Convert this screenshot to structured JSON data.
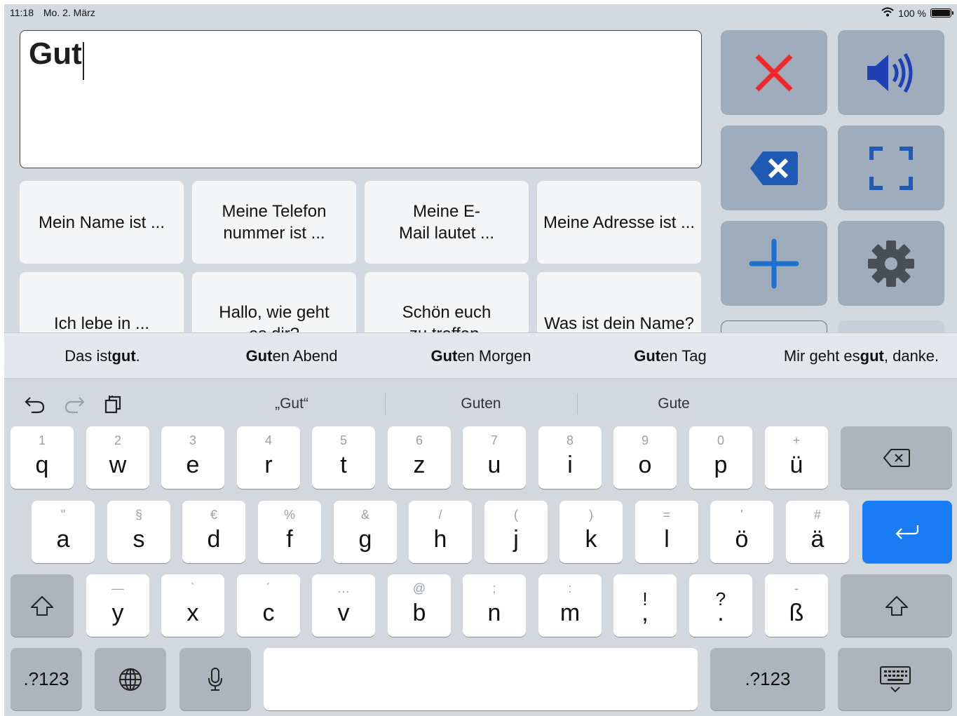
{
  "status": {
    "time": "11:18",
    "date": "Mo. 2. März",
    "battery": "100 %"
  },
  "textbox": {
    "value": "Gut"
  },
  "phrases": [
    "Mein Name ist ...",
    "Meine Telefon\nnummer ist ...",
    "Meine E-\nMail lautet ...",
    "Meine Adresse ist ...",
    "Ich lebe in ...",
    "Hallo, wie geht\nes dir?",
    "Schön euch\nzu treffen.",
    "Was ist dein Name?"
  ],
  "predictions": [
    {
      "pre": "Das ist ",
      "bold": "gut",
      "post": "."
    },
    {
      "pre": "",
      "bold": "Gut",
      "post": "en Abend"
    },
    {
      "pre": "",
      "bold": "Gut",
      "post": "en Morgen"
    },
    {
      "pre": "",
      "bold": "Gut",
      "post": "en Tag"
    },
    {
      "pre": "Mir geht es ",
      "bold": "gut",
      "post": ", danke."
    }
  ],
  "suggestions": [
    "„Gut“",
    "Guten",
    "Gute"
  ],
  "keys": {
    "row1": [
      {
        "alt": "1",
        "main": "q"
      },
      {
        "alt": "2",
        "main": "w"
      },
      {
        "alt": "3",
        "main": "e"
      },
      {
        "alt": "4",
        "main": "r"
      },
      {
        "alt": "5",
        "main": "t"
      },
      {
        "alt": "6",
        "main": "z"
      },
      {
        "alt": "7",
        "main": "u"
      },
      {
        "alt": "8",
        "main": "i"
      },
      {
        "alt": "9",
        "main": "o"
      },
      {
        "alt": "0",
        "main": "p"
      },
      {
        "alt": "+",
        "main": "ü"
      }
    ],
    "row2": [
      {
        "alt": "\"",
        "main": "a"
      },
      {
        "alt": "§",
        "main": "s"
      },
      {
        "alt": "€",
        "main": "d"
      },
      {
        "alt": "%",
        "main": "f"
      },
      {
        "alt": "&",
        "main": "g"
      },
      {
        "alt": "/",
        "main": "h"
      },
      {
        "alt": "(",
        "main": "j"
      },
      {
        "alt": ")",
        "main": "k"
      },
      {
        "alt": "=",
        "main": "l"
      },
      {
        "alt": "'",
        "main": "ö"
      },
      {
        "alt": "#",
        "main": "ä"
      }
    ],
    "row3": [
      {
        "alt": "—",
        "main": "y"
      },
      {
        "alt": "`",
        "main": "x"
      },
      {
        "alt": "´",
        "main": "c"
      },
      {
        "alt": "…",
        "main": "v"
      },
      {
        "alt": "@",
        "main": "b"
      },
      {
        "alt": ";",
        "main": "n"
      },
      {
        "alt": ":",
        "main": "m"
      },
      {
        "alt": "!",
        "main": ","
      },
      {
        "alt": "?",
        "main": "."
      },
      {
        "alt": "-",
        "main": "ß"
      }
    ],
    "numbers_label": ".?123"
  },
  "colors": {
    "accent_blue": "#1a7cf2",
    "delete_red": "#f02a2a",
    "icon_blue": "#1f5bb5",
    "action_bg": "#9eacbb"
  },
  "icons": [
    "close-icon",
    "speaker-icon",
    "backspace-icon",
    "fullscreen-icon",
    "plus-icon",
    "gear-icon",
    "undo-icon",
    "redo-icon",
    "paste-icon",
    "globe-icon",
    "microphone-icon",
    "keyboard-hide-icon",
    "shift-icon",
    "return-icon",
    "wifi-icon",
    "battery-icon"
  ]
}
